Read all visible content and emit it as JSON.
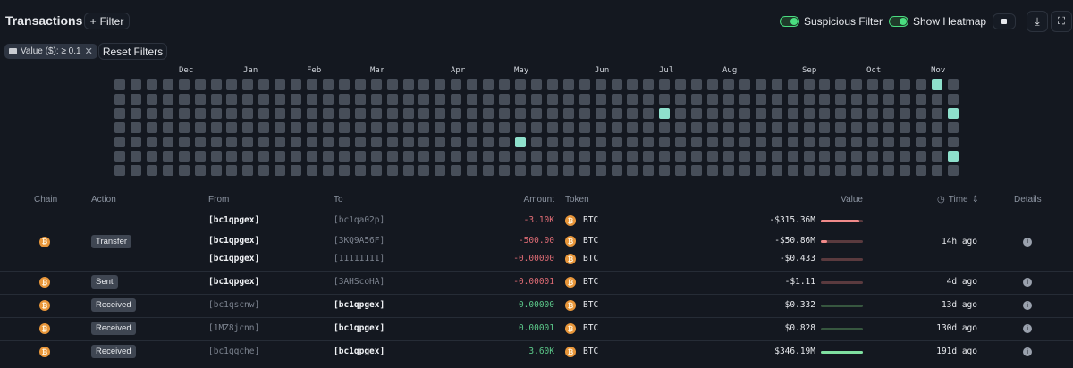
{
  "header": {
    "title": "Transactions",
    "filter_label": "Filter",
    "suspicious_label": "Suspicious Filter",
    "heatmap_label": "Show Heatmap",
    "suspicious_on": true,
    "heatmap_on": true
  },
  "filters": {
    "chip_label": "Value ($): ≥ 0.1",
    "reset_label": "Reset Filters"
  },
  "heatmap": {
    "months": [
      "Dec",
      "Jan",
      "Feb",
      "Mar",
      "Apr",
      "May",
      "Jun",
      "Jul",
      "Aug",
      "Sep",
      "Oct",
      "Nov"
    ],
    "weeks": 53,
    "days": 7,
    "active_cells": [
      {
        "week": 51,
        "day": 0
      },
      {
        "week": 34,
        "day": 2
      },
      {
        "week": 52,
        "day": 2
      },
      {
        "week": 25,
        "day": 4
      },
      {
        "week": 52,
        "day": 5
      }
    ],
    "colors": {
      "empty": "#474e59",
      "active": "#8ee0cc"
    }
  },
  "table": {
    "columns": [
      "Chain",
      "Action",
      "From",
      "To",
      "Amount",
      "Token",
      "Value",
      "Time",
      "Details"
    ],
    "groups": [
      {
        "action": "Transfer",
        "time": "14h ago",
        "lines": [
          {
            "from": "[bc1qpgex]",
            "to": "[bc1qa02p]",
            "amount": "-3.10K",
            "token": "BTC",
            "value": "-$315.36M",
            "fill": 0.91
          },
          {
            "from": "[bc1qpgex]",
            "to": "[3KQ9A56F]",
            "amount": "-500.00",
            "token": "BTC",
            "value": "-$50.86M",
            "fill": 0.15
          },
          {
            "from": "[bc1qpgex]",
            "to": "[11111111]",
            "amount": "-0.00000",
            "token": "BTC",
            "value": "-$0.433",
            "fill": 0
          }
        ]
      },
      {
        "action": "Sent",
        "time": "4d ago",
        "lines": [
          {
            "from": "[bc1qpgex]",
            "to": "[3AHScoHA]",
            "amount": "-0.00001",
            "token": "BTC",
            "value": "-$1.11",
            "fill": 0
          }
        ]
      },
      {
        "action": "Received",
        "time": "13d ago",
        "lines": [
          {
            "from": "[bc1qscnw]",
            "to": "[bc1qpgex]",
            "amount": "0.00000",
            "token": "BTC",
            "value": "$0.332",
            "fill": 0
          }
        ]
      },
      {
        "action": "Received",
        "time": "130d ago",
        "lines": [
          {
            "from": "[1MZ8jcnn]",
            "to": "[bc1qpgex]",
            "amount": "0.00001",
            "token": "BTC",
            "value": "$0.828",
            "fill": 0
          }
        ]
      },
      {
        "action": "Received",
        "time": "191d ago",
        "lines": [
          {
            "from": "[bc1qqche]",
            "to": "[bc1qpgex]",
            "amount": "3.60K",
            "token": "BTC",
            "value": "$346.19M",
            "fill": 1
          }
        ]
      }
    ]
  }
}
